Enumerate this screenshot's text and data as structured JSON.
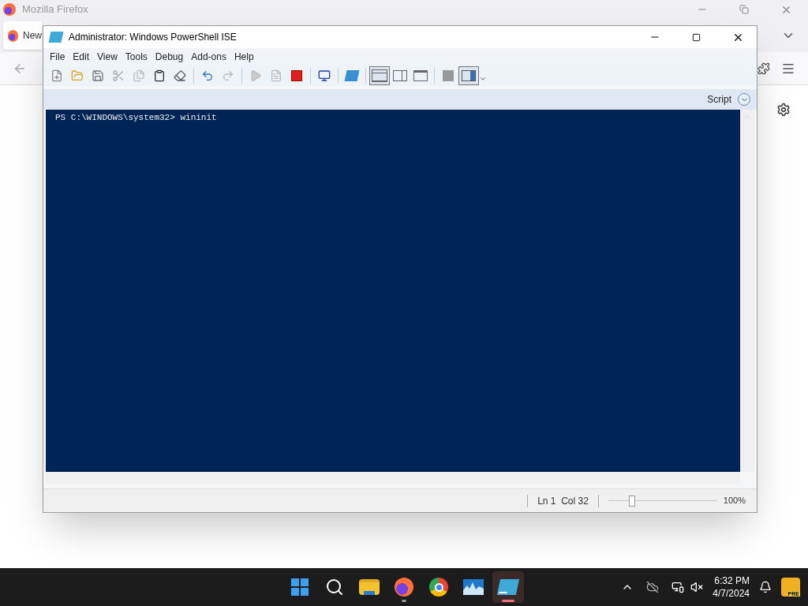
{
  "browser": {
    "title": "Mozilla Firefox",
    "tab_label": "New"
  },
  "ise": {
    "title": "Administrator: Windows PowerShell ISE",
    "menu": [
      "File",
      "Edit",
      "View",
      "Tools",
      "Debug",
      "Add-ons",
      "Help"
    ],
    "toolbar": [
      [
        {
          "kind": "new",
          "selected": false
        },
        {
          "kind": "open",
          "selected": false
        },
        {
          "kind": "save",
          "selected": false
        },
        {
          "kind": "cut",
          "selected": false
        },
        {
          "kind": "copy",
          "selected": false
        },
        {
          "kind": "paste",
          "selected": false
        },
        {
          "kind": "clear",
          "selected": false
        }
      ],
      [
        {
          "kind": "undo",
          "selected": false
        },
        {
          "kind": "redo",
          "selected": false
        }
      ],
      [
        {
          "kind": "run",
          "selected": false
        },
        {
          "kind": "runsel",
          "selected": false
        },
        {
          "kind": "stop",
          "selected": false
        }
      ],
      [
        {
          "kind": "remote",
          "selected": false
        }
      ],
      [
        {
          "kind": "console",
          "selected": false
        }
      ],
      [
        {
          "kind": "layout-top",
          "selected": true
        },
        {
          "kind": "layout-right",
          "selected": false
        },
        {
          "kind": "layout-max",
          "selected": false
        }
      ],
      [
        {
          "kind": "cmd",
          "selected": false
        },
        {
          "kind": "cmd-pane",
          "selected": true
        }
      ]
    ],
    "pane_label": "Script",
    "console_line": "PS C:\\WINDOWS\\system32> wininit",
    "position": "Ln 1  Col 32",
    "zoom": {
      "level": 0.22,
      "reading": "100%"
    }
  },
  "taskbar": {
    "apps": [
      {
        "kind": "start",
        "running": false,
        "selected": false
      },
      {
        "kind": "search",
        "running": false,
        "selected": false
      },
      {
        "kind": "files",
        "running": false,
        "selected": false
      },
      {
        "kind": "firefox",
        "running": true,
        "selected": false
      },
      {
        "kind": "chrome",
        "running": false,
        "selected": false
      },
      {
        "kind": "monitor",
        "running": false,
        "selected": false
      },
      {
        "kind": "powershell",
        "running": true,
        "selected": true
      }
    ],
    "time": "6:32 PM",
    "date": "4/7/2024",
    "badge": "PRE"
  }
}
